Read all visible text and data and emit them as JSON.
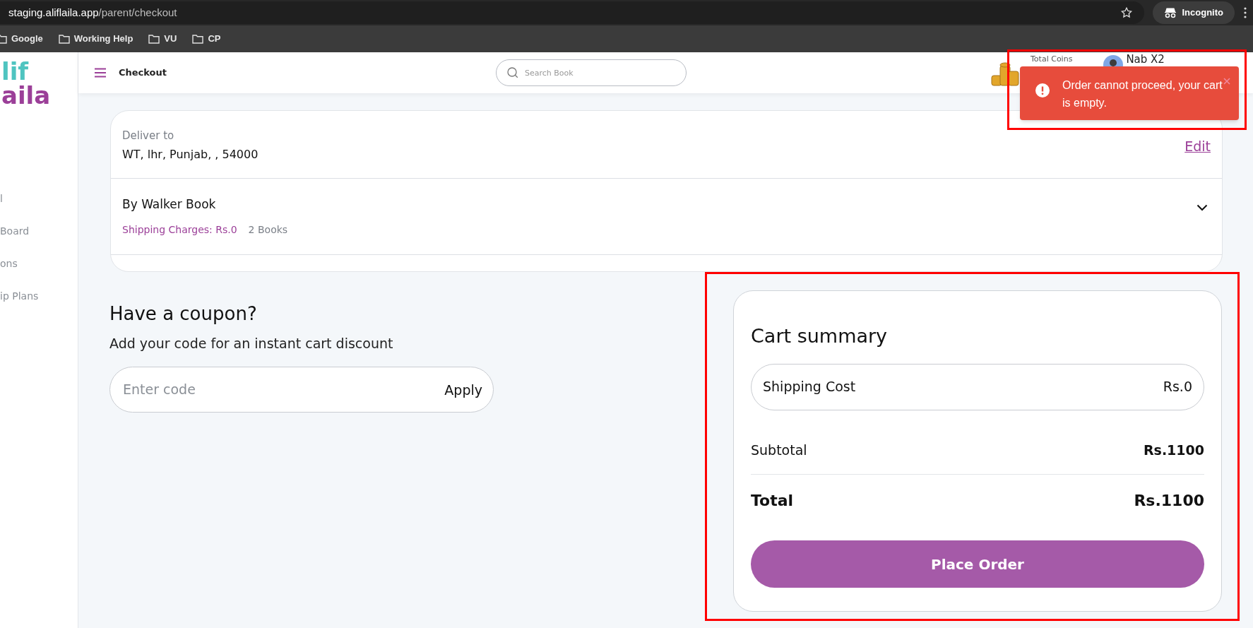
{
  "browser": {
    "url_host": "staging.aliflaila.app",
    "url_path": "/parent/checkout",
    "profile": "Incognito",
    "bookmarks": [
      "Google",
      "Working Help",
      "VU",
      "CP"
    ]
  },
  "sidebar": {
    "logo": [
      "lif",
      "aila"
    ],
    "items": [
      "l",
      "Board",
      "ons",
      "ip Plans"
    ]
  },
  "header": {
    "title": "Checkout",
    "search": {
      "placeholder": "Search Book"
    },
    "coins_label": "Total Coins",
    "user_name": "Nab X2"
  },
  "toast": {
    "message": "Order cannot proceed, your cart is empty."
  },
  "delivery": {
    "label": "Deliver to",
    "address": "WT, lhr, Punjab, , 54000",
    "edit": "Edit"
  },
  "seller": {
    "name": "By Walker Book",
    "shipping": "Shipping Charges: Rs.0",
    "count": "2 Books",
    "expanded": false
  },
  "coupon": {
    "title": "Have a coupon?",
    "subtitle": "Add your code for an instant cart discount",
    "placeholder": "Enter code",
    "button": "Apply"
  },
  "cart": {
    "title": "Cart summary",
    "shipping_label": "Shipping Cost",
    "shipping_value": "Rs.0",
    "subtotal_label": "Subtotal",
    "subtotal_value": "Rs.1100",
    "total_label": "Total",
    "total_value": "Rs.1100",
    "button": "Place Order"
  }
}
